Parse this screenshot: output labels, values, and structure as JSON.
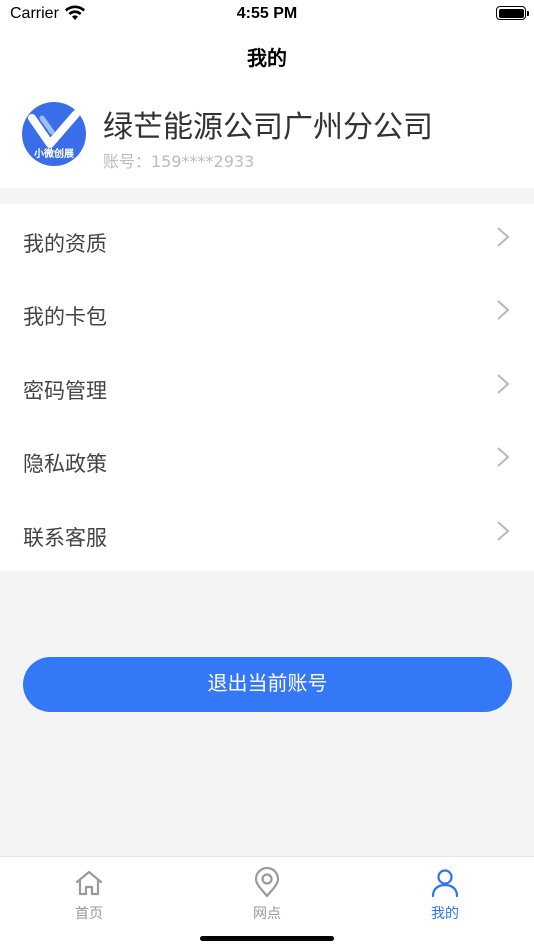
{
  "status_bar": {
    "carrier": "Carrier",
    "time": "4:55 PM"
  },
  "nav": {
    "title": "我的"
  },
  "profile": {
    "avatar_text": "小微创展",
    "company": "绿芒能源公司广州分公司",
    "account": "账号：159****2933"
  },
  "menu": {
    "items": [
      {
        "label": "我的资质"
      },
      {
        "label": "我的卡包"
      },
      {
        "label": "密码管理"
      },
      {
        "label": "隐私政策"
      },
      {
        "label": "联系客服"
      }
    ]
  },
  "logout": {
    "label": "退出当前账号"
  },
  "tabs": [
    {
      "label": "首页",
      "icon": "home-icon"
    },
    {
      "label": "网点",
      "icon": "location-pin-icon"
    },
    {
      "label": "我的",
      "icon": "user-icon",
      "active": true
    }
  ],
  "colors": {
    "accent": "#3478f6",
    "tab_active": "#2f72f5",
    "tab_inactive": "#999999"
  }
}
